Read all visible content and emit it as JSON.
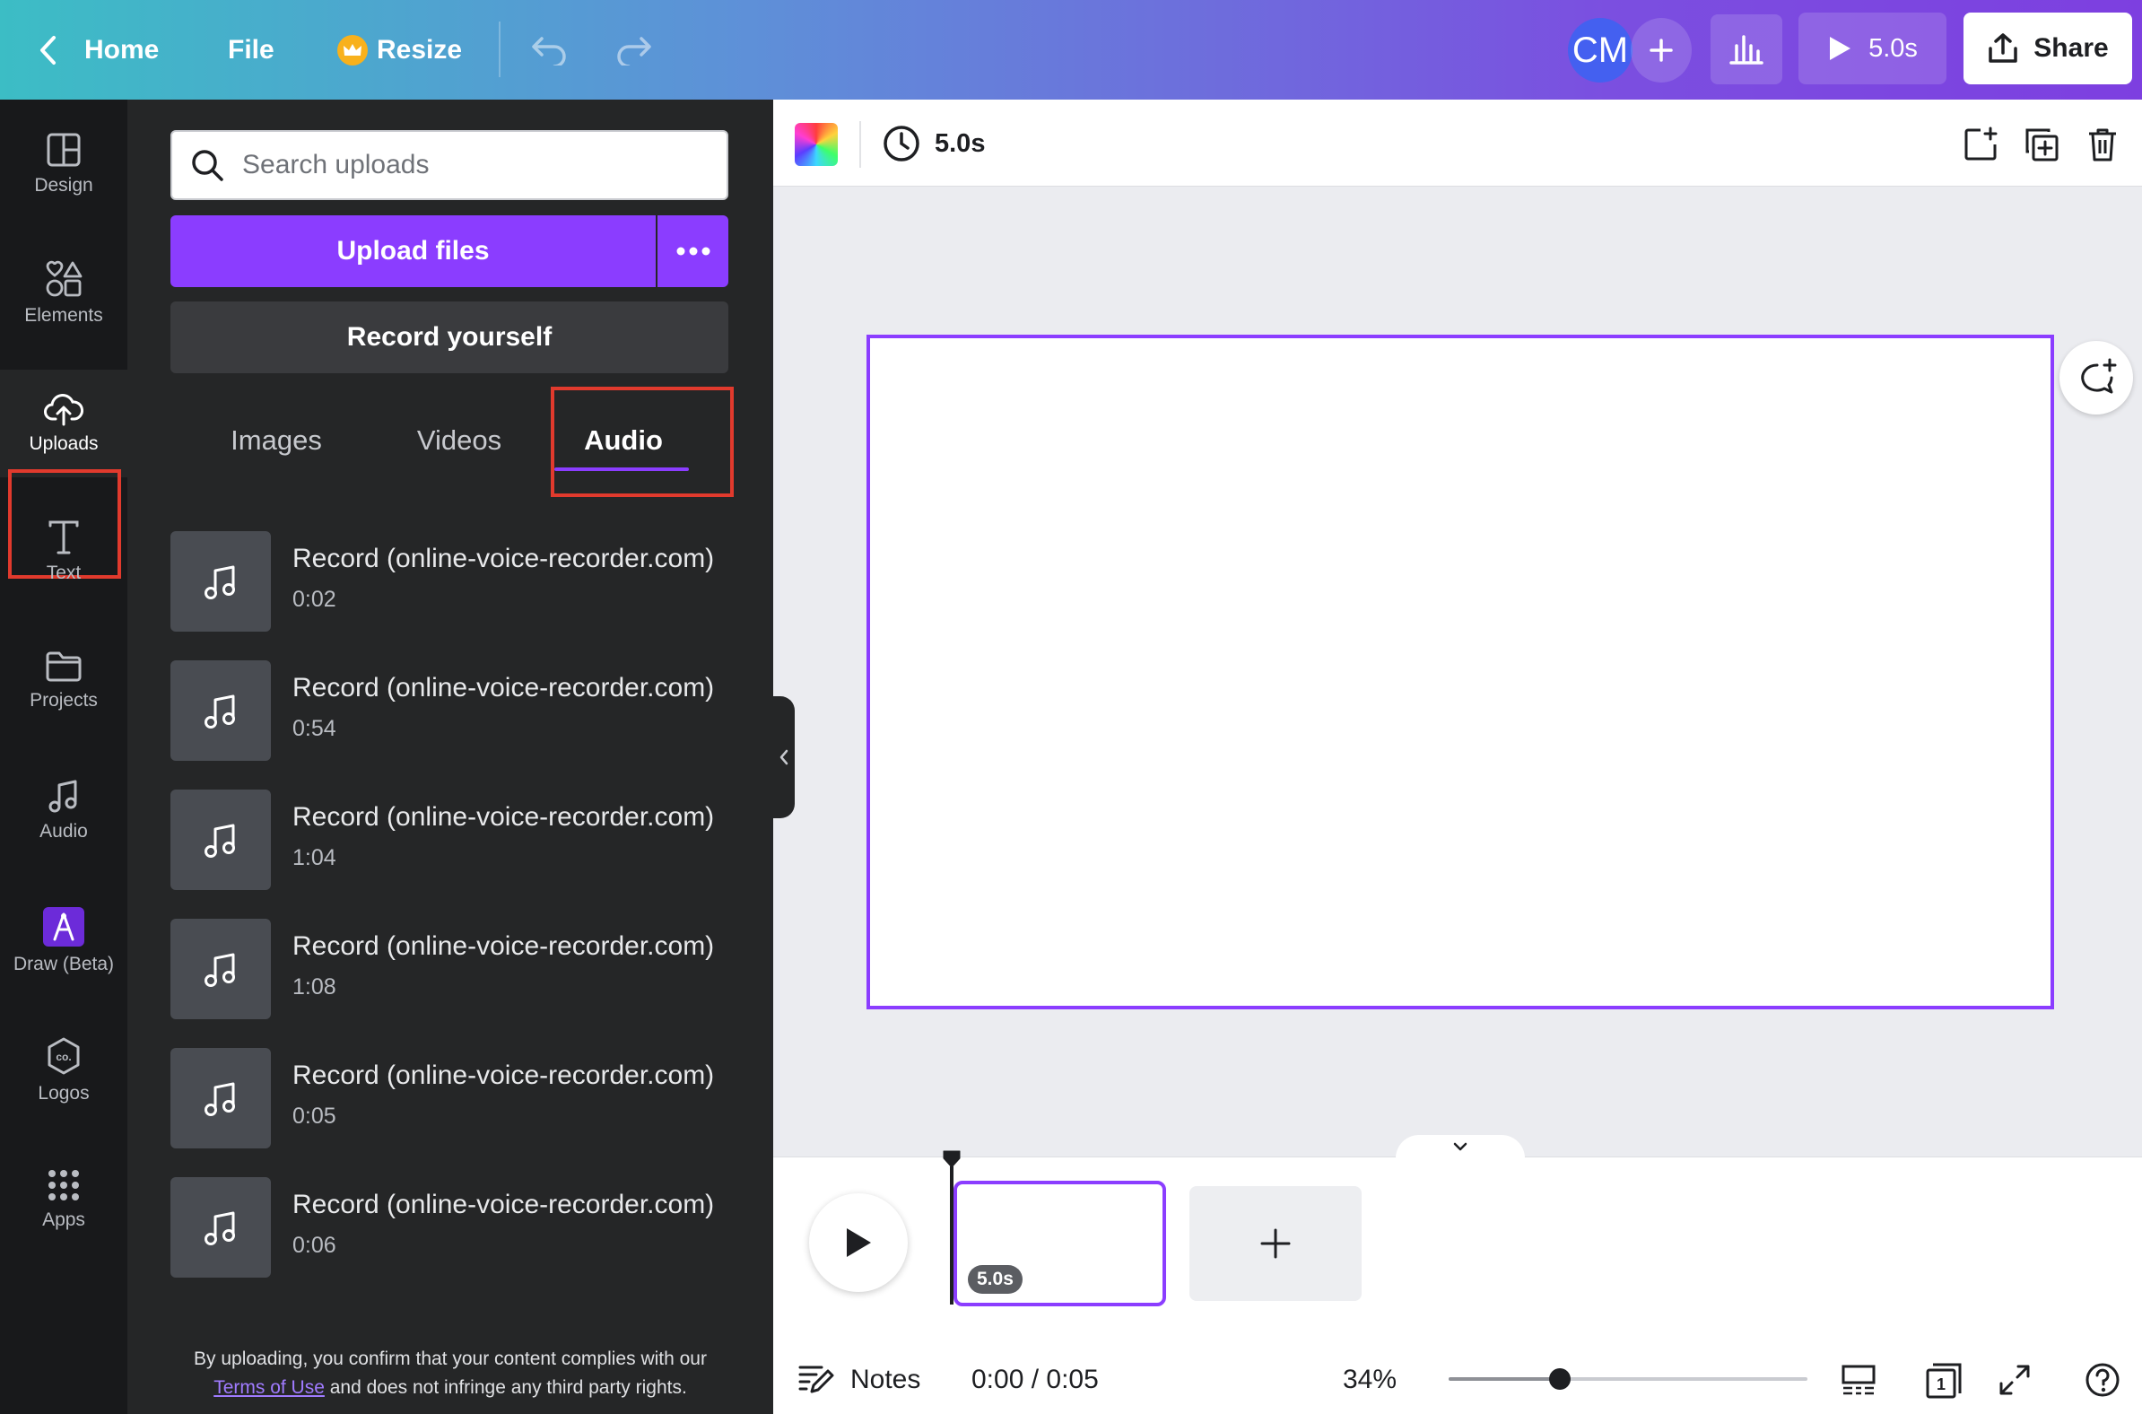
{
  "topbar": {
    "home_label": "Home",
    "file_label": "File",
    "resize_label": "Resize",
    "avatar_initials": "CM",
    "play_duration": "5.0s",
    "share_label": "Share"
  },
  "sidebar": {
    "items": [
      {
        "label": "Design",
        "icon": "design-icon"
      },
      {
        "label": "Elements",
        "icon": "elements-icon"
      },
      {
        "label": "Uploads",
        "icon": "upload-cloud-icon",
        "active": true
      },
      {
        "label": "Text",
        "icon": "text-icon"
      },
      {
        "label": "Projects",
        "icon": "folder-icon"
      },
      {
        "label": "Audio",
        "icon": "music-note-icon"
      },
      {
        "label": "Draw (Beta)",
        "icon": "draw-icon"
      },
      {
        "label": "Logos",
        "icon": "logo-badge-icon"
      },
      {
        "label": "Apps",
        "icon": "apps-grid-icon"
      }
    ]
  },
  "uploads": {
    "search_placeholder": "Search uploads",
    "upload_button": "Upload files",
    "record_button": "Record yourself",
    "tabs": [
      "Images",
      "Videos",
      "Audio"
    ],
    "active_tab": "Audio",
    "audio_items": [
      {
        "name": "Record (online-voice-recorder.com)",
        "duration": "0:02"
      },
      {
        "name": "Record (online-voice-recorder.com)",
        "duration": "0:54"
      },
      {
        "name": "Record (online-voice-recorder.com)",
        "duration": "1:04"
      },
      {
        "name": "Record (online-voice-recorder.com)",
        "duration": "1:08"
      },
      {
        "name": "Record (online-voice-recorder.com)",
        "duration": "0:05"
      },
      {
        "name": "Record (online-voice-recorder.com)",
        "duration": "0:06"
      }
    ],
    "terms_before": "By uploading, you confirm that your content complies with our",
    "terms_link": "Terms of Use",
    "terms_after": "and does not infringe any third party rights."
  },
  "editor": {
    "page_duration": "5.0s"
  },
  "timeline": {
    "clip_duration": "5.0s",
    "notes_label": "Notes",
    "time_display": "0:00 / 0:05",
    "zoom": "34%",
    "zoom_fraction": 0.31,
    "page_count": "1"
  },
  "colors": {
    "accent": "#8b3dff",
    "highlight": "#e13a2d",
    "panel_bg": "#252627",
    "rail_bg": "#18191b"
  }
}
